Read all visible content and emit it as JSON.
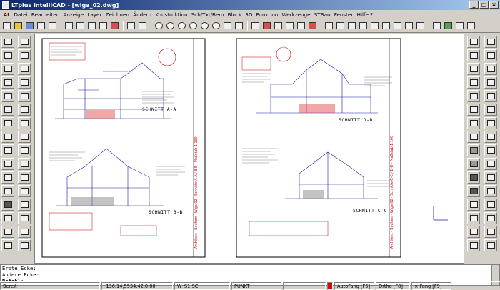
{
  "window": {
    "title": "LTplus IntelliCAD - [wiga_02.dwg]"
  },
  "menu": [
    "AI",
    "Datei",
    "Bearbeiten",
    "Anzeige",
    "Layer",
    "Zeichnen",
    "Ändern",
    "Konstruktion",
    "Sch/Txt/Bem",
    "Block",
    "3D",
    "Funktion",
    "Werkzeuge",
    "STBau",
    "Fenster",
    "Hilfe ?"
  ],
  "drawing": {
    "schnitt_labels": [
      "SCHNITT A-A",
      "SCHNITT B-B",
      "SCHNITT D-D",
      "SCHNITT C-C"
    ],
    "sheet_strip_left": "Architekt · Bauherr · Wiga 02 · Schnitte A-A / B-B · Maßstab 1:100",
    "sheet_strip_right": "Architekt · Bauherr · Wiga 02 · Schnitte C-C / D-D · Maßstab 1:100"
  },
  "command": {
    "lines": [
      "Erste Ecke:",
      "Andere Ecke:"
    ],
    "prompt": "Befehl:"
  },
  "status": {
    "left": "Bereit",
    "coords": "-136.14,5534.42,0.00",
    "layer": "W_S1-SCH",
    "linetype": "PUNKT",
    "autofang": "AutoFang  [F5]",
    "ortho": "Ortho  [F8]",
    "fang": "× Fang [F9]"
  }
}
